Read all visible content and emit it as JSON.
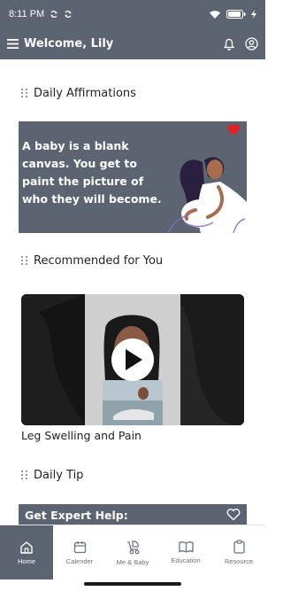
{
  "status_bar": {
    "time": "8:11 PM"
  },
  "app_bar": {
    "title": "Welcome, Lily"
  },
  "sections": {
    "affirmations_title": "Daily Affirmations",
    "recommended_title": "Recommended for You",
    "daily_tip_title": "Daily Tip"
  },
  "affirmation": {
    "text": "A baby is a blank canvas. You get to paint the picture of who they will become."
  },
  "video": {
    "caption": "Leg Swelling and Pain"
  },
  "expert": {
    "title": "Get Expert Help:"
  },
  "bottom_nav": {
    "items": [
      {
        "label": "Home",
        "icon": "home-icon",
        "active": true
      },
      {
        "label": "Calender",
        "icon": "calendar-icon",
        "active": false
      },
      {
        "label": "Me & Baby",
        "icon": "stroller-icon",
        "active": false
      },
      {
        "label": "Education",
        "icon": "book-icon",
        "active": false
      },
      {
        "label": "Resource",
        "icon": "clipboard-icon",
        "active": false
      }
    ]
  },
  "colors": {
    "primary": "#5b6470",
    "heart": "#e0202a",
    "white": "#ffffff"
  }
}
